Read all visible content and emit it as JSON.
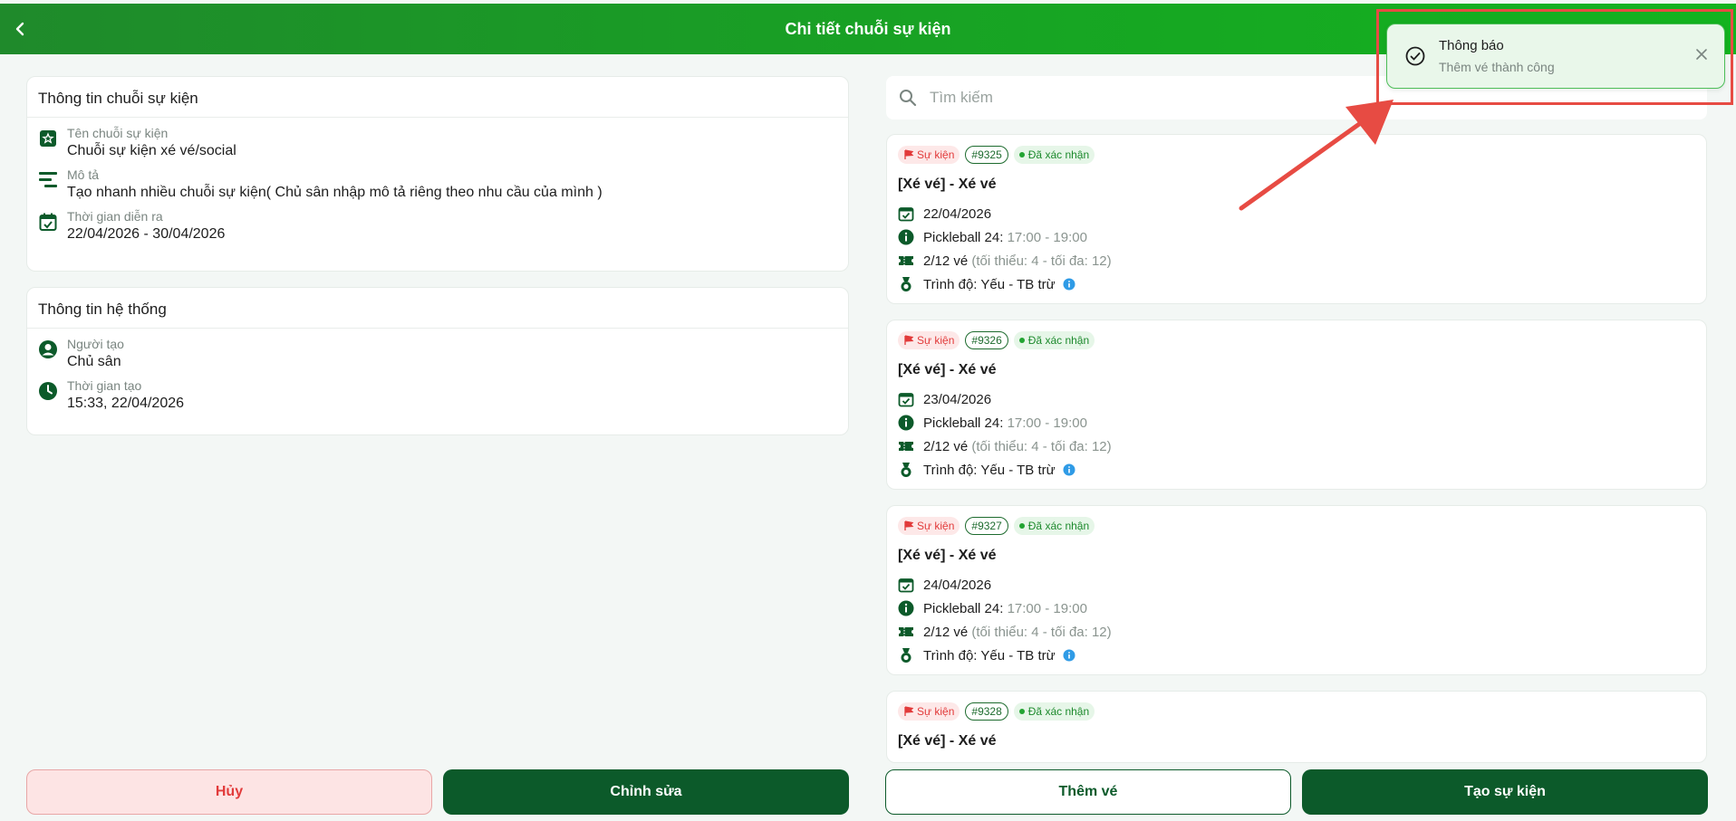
{
  "header": {
    "title": "Chi tiết chuỗi sự kiện"
  },
  "series_info": {
    "title": "Thông tin chuỗi sự kiện",
    "name_label": "Tên chuỗi sự kiện",
    "name_value": "Chuỗi sự kiện xé vé/social",
    "desc_label": "Mô tả",
    "desc_value": "Tạo nhanh nhiều chuỗi sự kiện( Chủ sân nhập mô tả riêng theo nhu cầu của mình )",
    "time_label": "Thời gian diễn ra",
    "time_value": "22/04/2026 - 30/04/2026"
  },
  "system_info": {
    "title": "Thông tin hệ thống",
    "creator_label": "Người tạo",
    "creator_value": "Chủ sân",
    "created_label": "Thời gian tạo",
    "created_value": "15:33, 22/04/2026"
  },
  "search": {
    "placeholder": "Tìm kiếm"
  },
  "events": [
    {
      "tag": "Sự kiện",
      "id": "#9325",
      "status": "Đã xác nhận",
      "title": "[Xé vé] - Xé vé",
      "date": "22/04/2026",
      "court": "Pickleball 24:",
      "time": "17:00 - 19:00",
      "tickets": "2/12 vé",
      "ticket_note": "(tối thiểu: 4 - tối đa: 12)",
      "level": "Trình độ: Yếu - TB trừ"
    },
    {
      "tag": "Sự kiện",
      "id": "#9326",
      "status": "Đã xác nhận",
      "title": "[Xé vé] - Xé vé",
      "date": "23/04/2026",
      "court": "Pickleball 24:",
      "time": "17:00 - 19:00",
      "tickets": "2/12 vé",
      "ticket_note": "(tối thiểu: 4 - tối đa: 12)",
      "level": "Trình độ: Yếu - TB trừ"
    },
    {
      "tag": "Sự kiện",
      "id": "#9327",
      "status": "Đã xác nhận",
      "title": "[Xé vé] - Xé vé",
      "date": "24/04/2026",
      "court": "Pickleball 24:",
      "time": "17:00 - 19:00",
      "tickets": "2/12 vé",
      "ticket_note": "(tối thiểu: 4 - tối đa: 12)",
      "level": "Trình độ: Yếu - TB trừ"
    },
    {
      "tag": "Sự kiện",
      "id": "#9328",
      "status": "Đã xác nhận",
      "title": "[Xé vé] - Xé vé"
    }
  ],
  "buttons": {
    "cancel": "Hủy",
    "edit": "Chỉnh sửa",
    "add_ticket": "Thêm vé",
    "create_event": "Tạo sự kiện"
  },
  "toast": {
    "title": "Thông báo",
    "message": "Thêm vé thành công"
  },
  "colors": {
    "primary": "#0c5a2a",
    "header": "#17a523",
    "danger": "#e23b3b",
    "annotation": "#e74b43"
  }
}
